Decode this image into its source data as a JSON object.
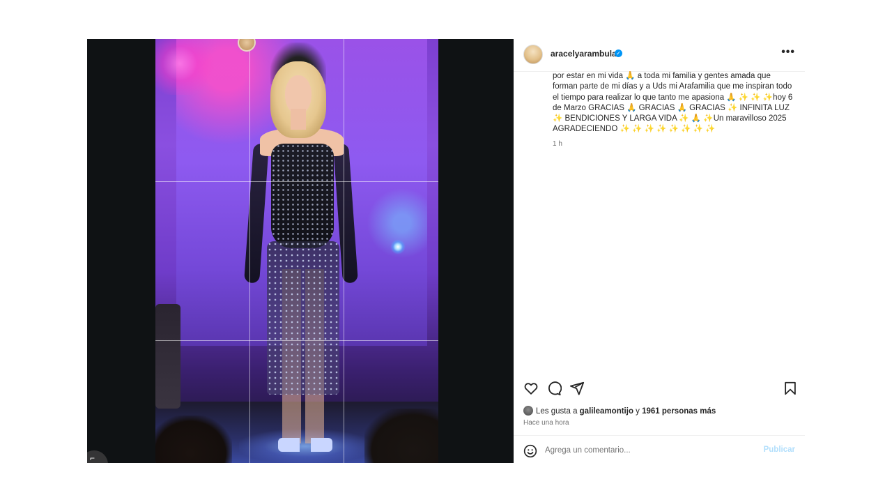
{
  "post": {
    "author": {
      "username": "aracelyarambula",
      "verified_mark": "✓"
    },
    "more_label": "•••",
    "caption": {
      "text": "por estar en mi vida 🙏 a toda mi familia y gentes amada que forman parte de mi días y a Uds mi Arafamilia que me inspiran todo el tiempo para realizar lo que tanto me apasiona 🙏 ✨ ✨ ✨hoy 6 de Marzo GRACIAS 🙏 GRACIAS 🙏 GRACIAS ✨ INFINITA LUZ ✨ BENDICIONES Y LARGA VIDA ✨ 🙏 ✨Un maravilloso 2025 AGRADECIENDO ✨ ✨ ✨ ✨ ✨ ✨ ✨ ✨",
      "time": "1 h"
    },
    "actions": {
      "like_icon": "heart-icon",
      "comment_icon": "comment-icon",
      "share_icon": "share-icon",
      "save_icon": "bookmark-icon"
    },
    "likes": {
      "prefix": "Les gusta a ",
      "user": "galileamontijo",
      "middle": " y ",
      "others": "1961 personas más"
    },
    "posted_ago": "Hace una hora",
    "comment": {
      "placeholder": "Agrega un comentario...",
      "publish_label": "Publicar",
      "emoji_icon": "emoji-icon"
    },
    "media": {
      "corner_glyph": "⌐"
    }
  },
  "colors": {
    "accent": "#0095f6",
    "text": "#262626",
    "muted": "#737373",
    "publish_disabled": "#b2dffc",
    "divider": "#efefef"
  }
}
